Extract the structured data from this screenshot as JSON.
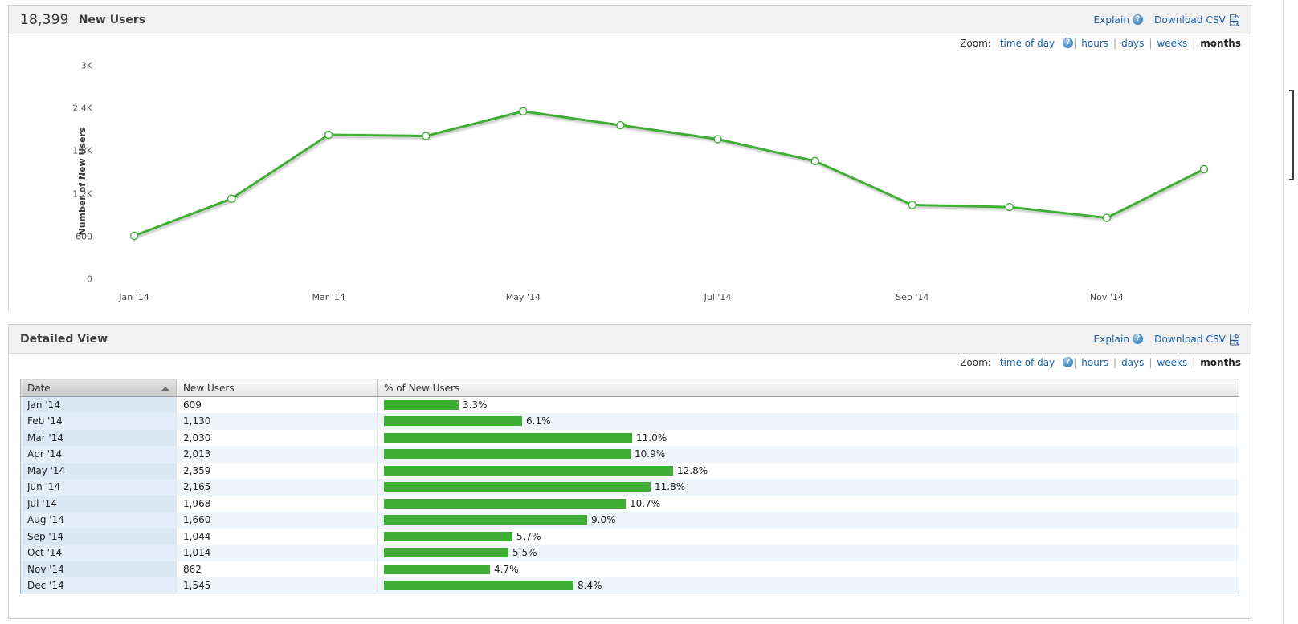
{
  "chart_panel": {
    "metric_value": "18,399",
    "metric_label": "New Users",
    "explain_label": "Explain",
    "download_label": "Download CSV",
    "help_glyph": "?",
    "zoom": {
      "label": "Zoom:",
      "options": [
        "time of day",
        "hours",
        "days",
        "weeks",
        "months"
      ],
      "active": "months",
      "separator": "|"
    }
  },
  "detail_panel": {
    "title": "Detailed View",
    "explain_label": "Explain",
    "download_label": "Download CSV",
    "help_glyph": "?",
    "zoom": {
      "label": "Zoom:",
      "options": [
        "time of day",
        "hours",
        "days",
        "weeks",
        "months"
      ],
      "active": "months",
      "separator": "|"
    },
    "table": {
      "columns": [
        "Date",
        "New Users",
        "% of New Users"
      ],
      "sorted_column": "Date",
      "sort_direction": "asc",
      "rows": [
        {
          "date": "Jan '14",
          "new_users": "609",
          "pct_label": "3.3%",
          "pct": 3.3
        },
        {
          "date": "Feb '14",
          "new_users": "1,130",
          "pct_label": "6.1%",
          "pct": 6.1
        },
        {
          "date": "Mar '14",
          "new_users": "2,030",
          "pct_label": "11.0%",
          "pct": 11.0
        },
        {
          "date": "Apr '14",
          "new_users": "2,013",
          "pct_label": "10.9%",
          "pct": 10.9
        },
        {
          "date": "May '14",
          "new_users": "2,359",
          "pct_label": "12.8%",
          "pct": 12.8
        },
        {
          "date": "Jun '14",
          "new_users": "2,165",
          "pct_label": "11.8%",
          "pct": 11.8
        },
        {
          "date": "Jul '14",
          "new_users": "1,968",
          "pct_label": "10.7%",
          "pct": 10.7
        },
        {
          "date": "Aug '14",
          "new_users": "1,660",
          "pct_label": "9.0%",
          "pct": 9.0
        },
        {
          "date": "Sep '14",
          "new_users": "1,044",
          "pct_label": "5.7%",
          "pct": 5.7
        },
        {
          "date": "Oct '14",
          "new_users": "1,014",
          "pct_label": "5.5%",
          "pct": 5.5
        },
        {
          "date": "Nov '14",
          "new_users": "862",
          "pct_label": "4.7%",
          "pct": 4.7
        },
        {
          "date": "Dec '14",
          "new_users": "1,545",
          "pct_label": "8.4%",
          "pct": 8.4
        }
      ]
    }
  },
  "colors": {
    "series_green": "#3fae35",
    "link_blue": "#1a5fa8",
    "panel_header": "#f1f1f1"
  },
  "chart_data": {
    "type": "line",
    "title": "New Users",
    "xlabel": "",
    "ylabel": "Number of New Users",
    "categories": [
      "Jan '14",
      "Feb '14",
      "Mar '14",
      "Apr '14",
      "May '14",
      "Jun '14",
      "Jul '14",
      "Aug '14",
      "Sep '14",
      "Oct '14",
      "Nov '14",
      "Dec '14"
    ],
    "x_tick_labels": [
      "Jan '14",
      "Mar '14",
      "May '14",
      "Jul '14",
      "Sep '14",
      "Nov '14"
    ],
    "y_tick_labels": [
      "0",
      "600",
      "1.2K",
      "1.8K",
      "2.4K",
      "3K"
    ],
    "y_tick_values": [
      0,
      600,
      1200,
      1800,
      2400,
      3000
    ],
    "ylim": [
      0,
      3000
    ],
    "grid": false,
    "legend": "none",
    "series": [
      {
        "name": "New Users",
        "color": "#3fae35",
        "marker": "open-circle",
        "values": [
          609,
          1130,
          2030,
          2013,
          2359,
          2165,
          1968,
          1660,
          1044,
          1014,
          862,
          1545
        ]
      }
    ]
  }
}
